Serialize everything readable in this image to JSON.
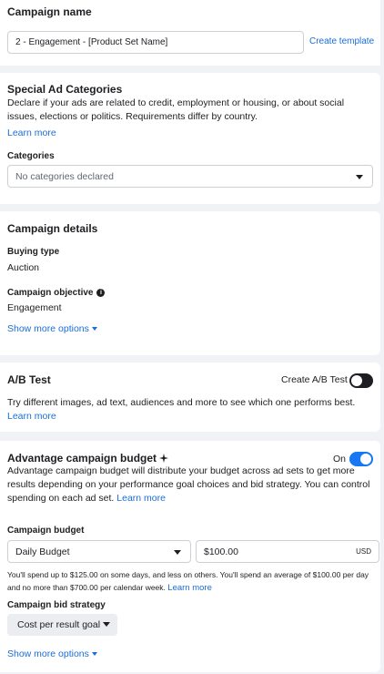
{
  "campaign_name": {
    "title": "Campaign name",
    "value": "2 - Engagement - [Product Set Name]",
    "create_template": "Create template"
  },
  "special_ad": {
    "title": "Special Ad Categories",
    "description": "Declare if your ads are related to credit, employment or housing, or about social issues, elections or politics. Requirements differ by country.",
    "learn_more": "Learn more",
    "categories_label": "Categories",
    "categories_value": "No categories declared"
  },
  "campaign_details": {
    "title": "Campaign details",
    "buying_type_label": "Buying type",
    "buying_type_value": "Auction",
    "objective_label": "Campaign objective",
    "objective_value": "Engagement",
    "show_more": "Show more options"
  },
  "ab_test": {
    "title": "A/B Test",
    "create_label": "Create A/B Test",
    "toggle_on": false,
    "description": "Try different images, ad text, audiences and more to see which one performs best.",
    "learn": "Learn",
    "more": "more"
  },
  "advantage": {
    "title": "Advantage campaign budget",
    "toggle_label": "On",
    "toggle_on": true,
    "description": "Advantage campaign budget will distribute your budget across ad sets to get more results depending on your performance goal choices and bid strategy. You can control spending on each ad set.",
    "learn_more": "Learn more",
    "budget_label": "Campaign budget",
    "budget_type": "Daily Budget",
    "budget_amount": "$100.00",
    "currency": "USD",
    "spend_note": "You'll spend up to $125.00 on some days, and less on others. You'll spend an average of $100.00 per day and no more than $700.00 per calendar week.",
    "spend_learn_more": "Learn more",
    "bid_label": "Campaign bid strategy",
    "bid_value": "Cost per result goal",
    "show_more": "Show more options"
  },
  "colors": {
    "link": "#1a6ed8",
    "toggle_on": "#1877f2",
    "toggle_off": "#1c1e21"
  }
}
